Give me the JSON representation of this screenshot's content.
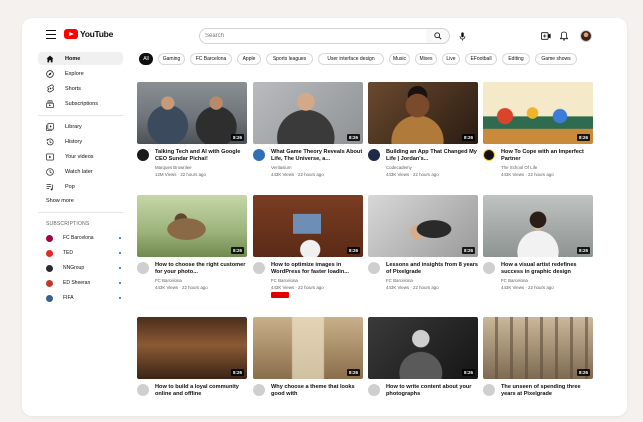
{
  "header": {
    "logo_text": "YouTube",
    "search_placeholder": "Search"
  },
  "sidebar": {
    "items": [
      {
        "label": "Home",
        "icon": "home-icon",
        "active": true
      },
      {
        "label": "Explore",
        "icon": "explore-icon"
      },
      {
        "label": "Shorts",
        "icon": "shorts-icon"
      },
      {
        "label": "Subscriptions",
        "icon": "subscriptions-icon"
      },
      {
        "label": "Library",
        "icon": "library-icon"
      },
      {
        "label": "History",
        "icon": "history-icon"
      },
      {
        "label": "Your videos",
        "icon": "your-videos-icon"
      },
      {
        "label": "Watch later",
        "icon": "watch-later-icon"
      },
      {
        "label": "Pop",
        "icon": "playlist-icon"
      }
    ],
    "show_more": "Show more",
    "subscriptions_heading": "SUBSCRIPTIONS",
    "subscriptions": [
      {
        "name": "FC Barcelona",
        "color": "#a50044"
      },
      {
        "name": "TED",
        "color": "#e62b1e"
      },
      {
        "name": "NNGroup",
        "color": "#2b2b2b"
      },
      {
        "name": "ED Sheeran",
        "color": "#c0392b"
      },
      {
        "name": "FIFA",
        "color": "#326295"
      }
    ]
  },
  "chips": [
    "All",
    "Gaming",
    "FC Barcelona",
    "Apple",
    "Sports leagues",
    "User interface design",
    "Music",
    "Mixes",
    "Live",
    "EFootball",
    "Editing",
    "Game shows"
  ],
  "videos": [
    {
      "title": "Talking Tech and AI with Google CEO Sundar Pichai!",
      "channel": "Marques Brownlee",
      "views": "12M Views",
      "age": "22 hours ago",
      "duration": "8:26"
    },
    {
      "title": "What Game Theory Reveals About Life, The Universe, a...",
      "channel": "Veritasium",
      "views": "443K Views",
      "age": "22 hours ago",
      "duration": "8:26"
    },
    {
      "title": "Building an App That Changed My Life | Jordan's...",
      "channel": "Codecademy",
      "views": "443K Views",
      "age": "22 hours ago",
      "duration": "8:26"
    },
    {
      "title": "How To Cope with an Imperfect Partner",
      "channel": "The School Of Life",
      "views": "443K Views",
      "age": "22 hours ago",
      "duration": "8:26"
    },
    {
      "title": "How to choose the right customer for your photo...",
      "channel": "FC Barcelona",
      "views": "443K Views",
      "age": "22 hours ago",
      "duration": "8:26"
    },
    {
      "title": "How to optimize images in WordPress for faster loadin...",
      "channel": "FC Barcelona",
      "views": "443K Views",
      "age": "22 hours ago",
      "duration": "8:26"
    },
    {
      "title": "Lessons and insights from 8 years of Pixelgrade",
      "channel": "FC Barcelona",
      "views": "443K Views",
      "age": "22 hours ago",
      "duration": "8:26"
    },
    {
      "title": "How a visual artist redefines success in graphic design",
      "channel": "FC Barcelona",
      "views": "443K Views",
      "age": "22 hours ago",
      "duration": "8:26"
    },
    {
      "title": "How to build a loyal community online and offline",
      "channel": "",
      "views": "",
      "age": "",
      "duration": "8:26"
    },
    {
      "title": "Why choose a theme that looks good with",
      "channel": "",
      "views": "",
      "age": "",
      "duration": "8:26"
    },
    {
      "title": "How to write content about your photographs",
      "channel": "",
      "views": "",
      "age": "",
      "duration": "8:26"
    },
    {
      "title": "The unseen of spending three years at Pixelgrade",
      "channel": "",
      "views": "",
      "age": "",
      "duration": "8:26"
    }
  ]
}
